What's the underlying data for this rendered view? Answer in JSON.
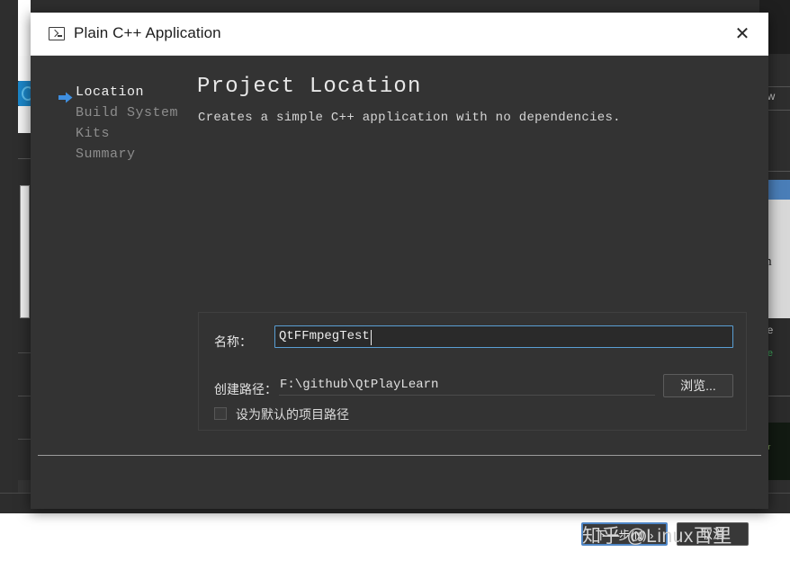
{
  "window": {
    "title": "Plain C++ Application",
    "icon": "console-icon",
    "close_label": "✕"
  },
  "sidebar": {
    "items": [
      {
        "label": "Location",
        "active": true
      },
      {
        "label": "Build System",
        "active": false
      },
      {
        "label": "Kits",
        "active": false
      },
      {
        "label": "Summary",
        "active": false
      }
    ]
  },
  "main": {
    "page_title": "Project Location",
    "page_subtitle": "Creates a simple C++ application with no dependencies."
  },
  "form": {
    "name_label": "名称：",
    "name_value": "QtFFmpegTest",
    "path_label": "创建路径：",
    "path_value": "F:\\github\\QtPlayLearn",
    "browse_label": "浏览...",
    "default_path_checkbox_label": "设为默认的项目路径",
    "default_path_checked": false
  },
  "footer": {
    "next_label": "下一步(N)  ›",
    "cancel_label": "取消"
  },
  "background": {
    "right_fragments": [
      "ow",
      "a",
      "m",
      "ne"
    ],
    "right_green_fragment": "re",
    "photo_fragment": "ter"
  },
  "watermark": {
    "text": "知乎 @Linux百里"
  },
  "colors": {
    "dialog_bg": "#333333",
    "titlebar_bg": "#ffffff",
    "accent_blue": "#5a9fd4",
    "default_button_border": "#4f86c6",
    "sidebar_active_text": "#f0f0f0",
    "sidebar_inactive_text": "#8d8d8d"
  }
}
